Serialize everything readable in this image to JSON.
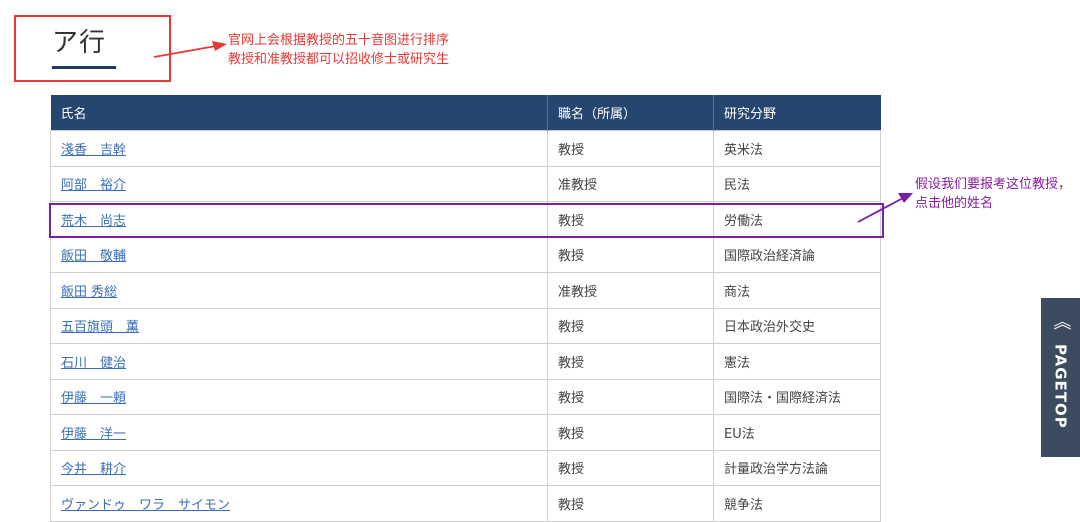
{
  "section": {
    "title": "ア行"
  },
  "annotations": {
    "red_line1": "官网上会根据教授的五十音图进行排序",
    "red_line2": "教授和准教授都可以招收修士或研究生",
    "purple_line1": "假设我们要报考这位教授，",
    "purple_line2": "点击他的姓名",
    "red_color": "#e53935",
    "purple_color": "#7b1fa2"
  },
  "table": {
    "headers": [
      "氏名",
      "職名（所属）",
      "研究分野"
    ],
    "rows": [
      {
        "name": "淺香　吉幹",
        "title": "教授",
        "field": "英米法"
      },
      {
        "name": "阿部　裕介",
        "title": "准教授",
        "field": "民法"
      },
      {
        "name": "荒木　尚志",
        "title": "教授",
        "field": "労働法"
      },
      {
        "name": "飯田　敬輔",
        "title": "教授",
        "field": "国際政治経済論"
      },
      {
        "name": "飯田 秀総",
        "title": "准教授",
        "field": "商法"
      },
      {
        "name": "五百旗頭　薫",
        "title": "教授",
        "field": "日本政治外交史"
      },
      {
        "name": "石川　健治",
        "title": "教授",
        "field": "憲法"
      },
      {
        "name": "伊藤　一頼",
        "title": "教授",
        "field": "国際法・国際経済法"
      },
      {
        "name": "伊藤　洋一",
        "title": "教授",
        "field": "EU法"
      },
      {
        "name": "今井　耕介",
        "title": "教授",
        "field": "計量政治学方法論"
      },
      {
        "name": "ヴァンドゥ　ワラ　サイモン",
        "title": "教授",
        "field": "競争法"
      }
    ],
    "header_color": "#24466f"
  },
  "pagetop": {
    "label": "PAGETOP",
    "icon": "double-chevron-up-icon"
  }
}
